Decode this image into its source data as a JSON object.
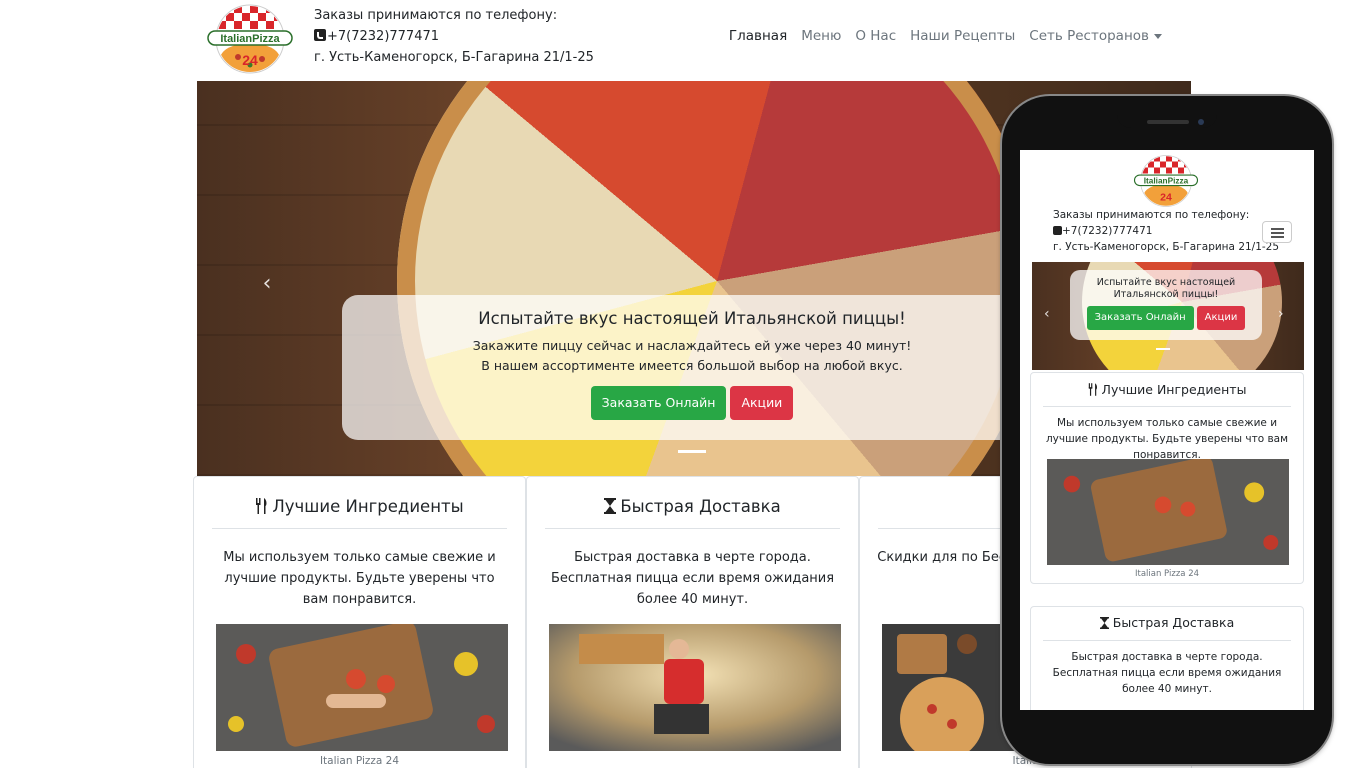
{
  "header": {
    "logo_text_top": "ItalianPizza",
    "logo_text_num": "24",
    "contact_title": "Заказы принимаются по телефону:",
    "phone": "+7(7232)777471",
    "address": "г. Усть-Каменогорск, Б-Гагарина 21/1-25"
  },
  "nav": {
    "items": [
      {
        "label": "Главная"
      },
      {
        "label": "Меню"
      },
      {
        "label": "О Нас"
      },
      {
        "label": "Наши Рецепты"
      },
      {
        "label": "Сеть Ресторанов"
      }
    ]
  },
  "hero": {
    "title": "Испытайте вкус настоящей Итальянской пиццы!",
    "line1": "Закажите пиццу сейчас и наслаждайтесь ей уже через 40 минут!",
    "line2": "В нашем ассортименте имеется большой выбор на любой вкус.",
    "order_button": "Заказать Онлайн",
    "promo_button": "Акции",
    "prev_icon": "‹"
  },
  "cards": [
    {
      "title": "Лучшие Ингредиенты",
      "text": "Мы используем только самые свежие и лучшие продукты. Будьте уверены что вам понравится.",
      "caption": "Italian Pizza 24"
    },
    {
      "title": "Быстрая Доставка",
      "text": "Быстрая доставка в черте города. Бесплатная пицца если время ожидания более 40 минут.",
      "caption": ""
    },
    {
      "title": "%",
      "text": "Скидки для по Бесплатный пиро предъявл",
      "caption": "Italia"
    }
  ],
  "mobile": {
    "contact_title": "Заказы принимаются по телефону:",
    "phone": "+7(7232)777471",
    "address": "г. Усть-Каменогорск, Б-Гагарина 21/1-25",
    "hero_title": "Испытайте вкус настоящей Итальянской пиццы!",
    "order_button": "Заказать Онлайн",
    "promo_button": "Акции",
    "prev_icon": "‹",
    "next_icon": "›",
    "card1_title": "Лучшие Ингредиенты",
    "card1_text": "Мы используем только самые свежие и лучшие продукты. Будьте уверены что вам понравится.",
    "card1_caption": "Italian Pizza 24",
    "card2_title": "Быстрая Доставка",
    "card2_text": "Быстрая доставка в черте города. Бесплатная пицца если время ожидания более 40 минут."
  },
  "colors": {
    "green": "#28a745",
    "red": "#dc3545",
    "muted": "#6c757d"
  }
}
